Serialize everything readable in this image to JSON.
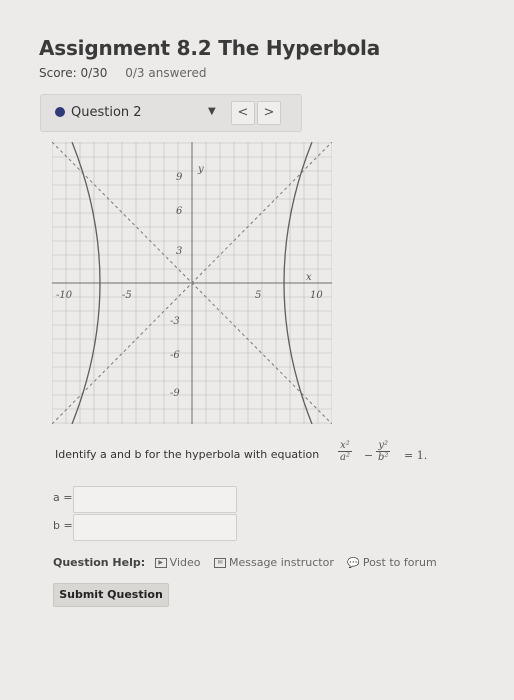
{
  "header": {
    "title": "Assignment 8.2 The Hyperbola",
    "score": "Score: 0/30",
    "answered": "0/3 answered"
  },
  "question_nav": {
    "label": "Question 2",
    "prev": "<",
    "next": ">"
  },
  "graph": {
    "y_axis_label": "y",
    "x_axis_label": "x",
    "x_ticks": [
      "-10",
      "-5",
      "5",
      "10"
    ],
    "y_ticks": [
      "9",
      "6",
      "3",
      "-3",
      "-6",
      "-9"
    ]
  },
  "question": {
    "prompt": "Identify a and b for the hyperbola with equation",
    "equation": {
      "term1_num": "x²",
      "term1_den": "a²",
      "minus": "−",
      "term2_num": "y²",
      "term2_den": "b²",
      "rhs": "= 1."
    }
  },
  "inputs": {
    "a_label": "a =",
    "b_label": "b ="
  },
  "help": {
    "label": "Question Help:",
    "video": "Video",
    "message": "Message instructor",
    "forum": "Post to forum"
  },
  "submit": "Submit Question"
}
